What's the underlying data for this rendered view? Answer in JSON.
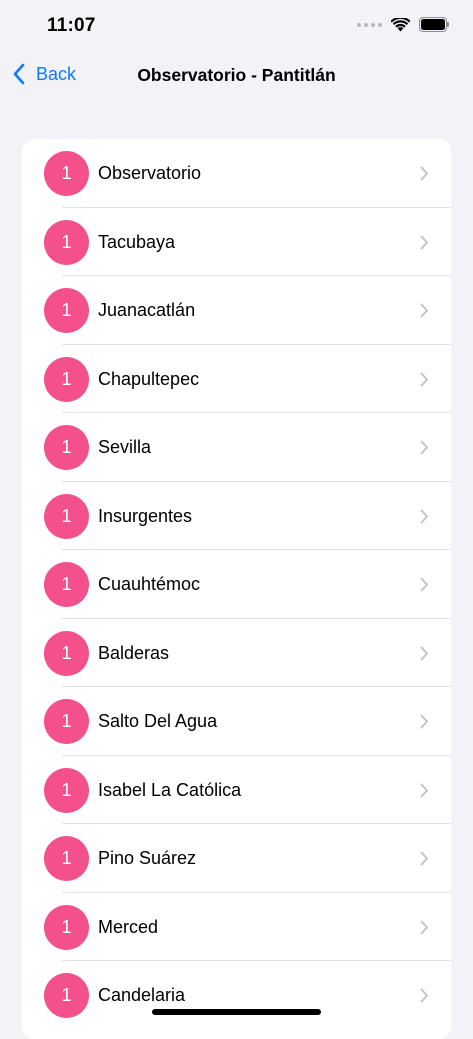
{
  "status_bar": {
    "time": "11:07"
  },
  "nav": {
    "back_label": "Back",
    "title": "Observatorio - Pantitlán"
  },
  "line": {
    "badge": "1",
    "color": "#f4508b"
  },
  "accent": "#0a7cff",
  "stations": [
    "Observatorio",
    "Tacubaya",
    "Juanacatlán",
    "Chapultepec",
    "Sevilla",
    "Insurgentes",
    "Cuauhtémoc",
    "Balderas",
    "Salto Del Agua",
    "Isabel La Católica",
    "Pino Suárez",
    "Merced",
    "Candelaria"
  ]
}
